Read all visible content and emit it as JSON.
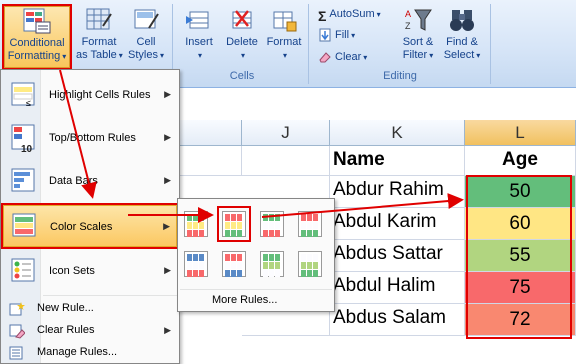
{
  "ribbon": {
    "conditional_formatting": [
      "Conditional",
      "Formatting"
    ],
    "format_as_table": [
      "Format",
      "as Table"
    ],
    "cell_styles": [
      "Cell",
      "Styles"
    ],
    "insert": "Insert",
    "delete": "Delete",
    "format": "Format",
    "cells_group": "Cells",
    "autosum": "AutoSum",
    "fill": "Fill",
    "clear": "Clear",
    "sort_filter": [
      "Sort &",
      "Filter"
    ],
    "find_select": [
      "Find &",
      "Select"
    ],
    "editing_group": "Editing"
  },
  "columns": [
    "J",
    "K",
    "L"
  ],
  "table": {
    "header_name": "Name",
    "header_age": "Age",
    "rows": [
      {
        "name": "Abdur Rahim",
        "age": "50",
        "color": "#63be7b"
      },
      {
        "name": "Abdul Karim",
        "age": "60",
        "color": "#ffe684"
      },
      {
        "name": "Abdus Sattar",
        "age": "55",
        "color": "#b1d580"
      },
      {
        "name": "Abdul Halim",
        "age": "75",
        "color": "#f8696b"
      },
      {
        "name": "Abdus Salam",
        "age": "72",
        "color": "#f98870"
      }
    ]
  },
  "menu": {
    "highlight": "Highlight Cells Rules",
    "topbottom": "Top/Bottom Rules",
    "databars": "Data Bars",
    "colorscales": "Color Scales",
    "iconsets": "Icon Sets",
    "newrule": "New Rule...",
    "clearrules": "Clear Rules",
    "managerules": "Manage Rules..."
  },
  "submenu": {
    "more_rules": "More Rules..."
  }
}
